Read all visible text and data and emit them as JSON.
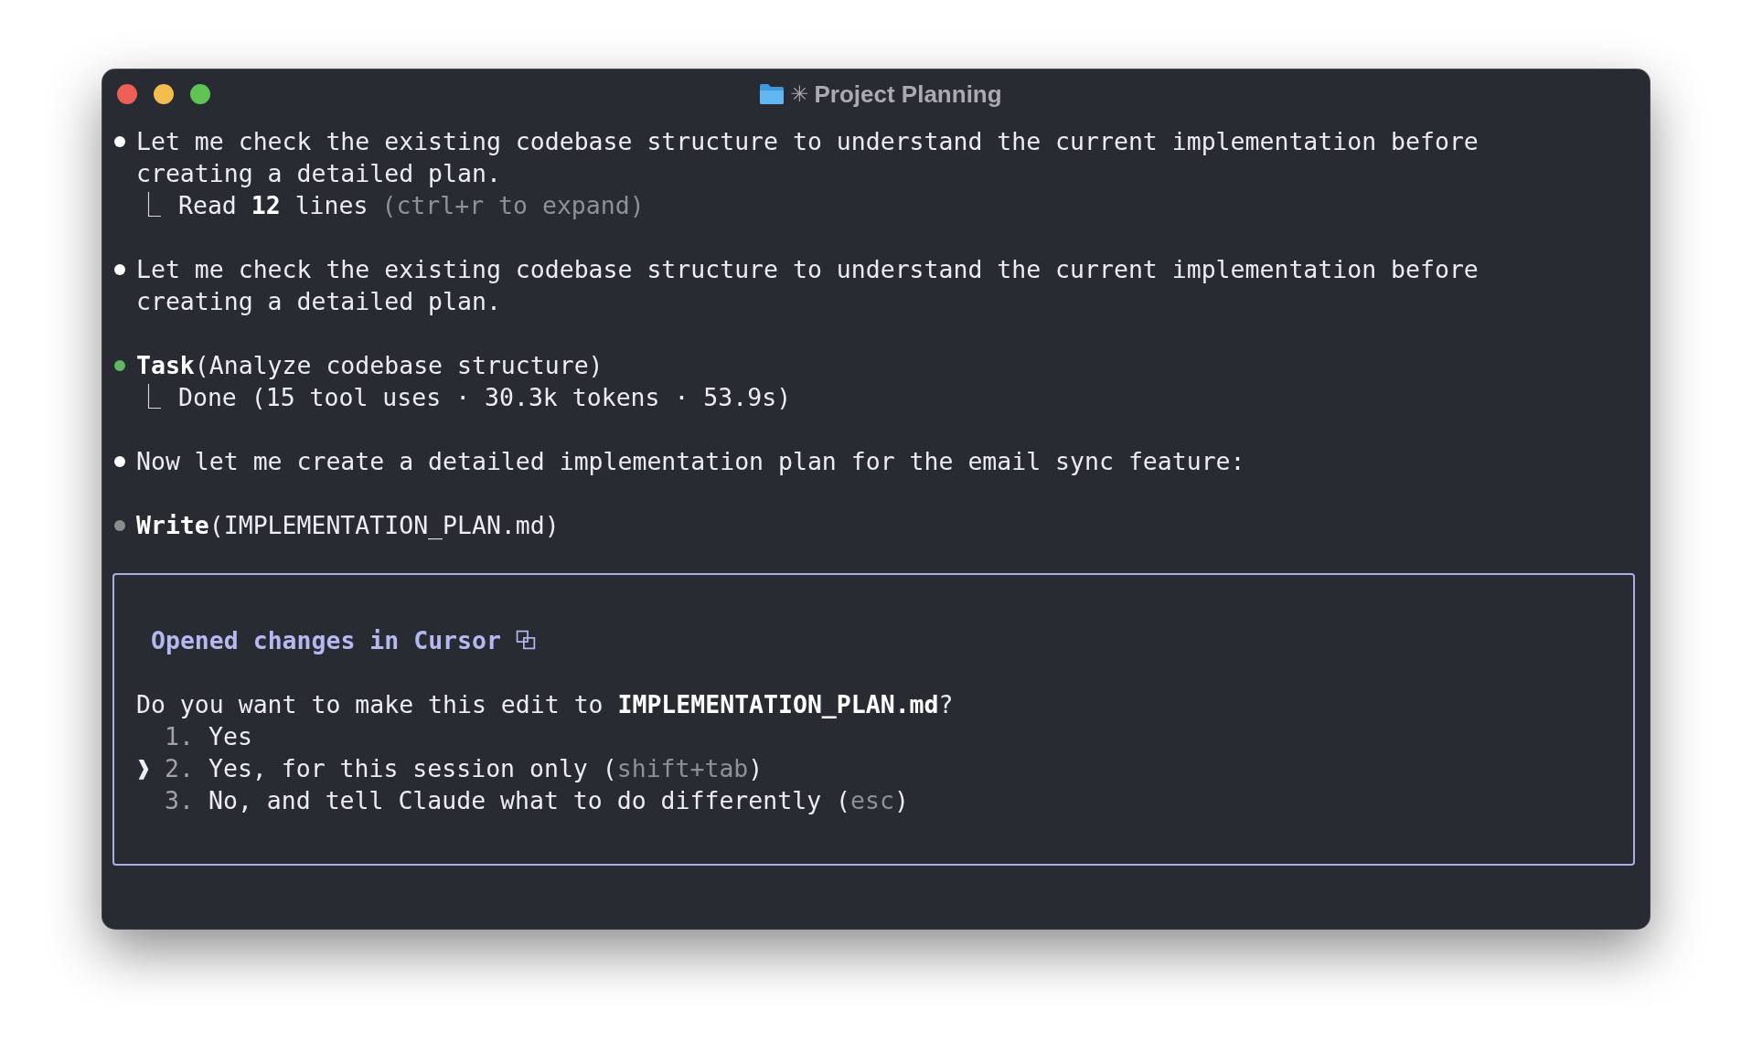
{
  "window": {
    "title_icon_glyph": "✳",
    "title": "Project Planning"
  },
  "messages": [
    {
      "kind": "text",
      "color": "#ffffff",
      "text": "Let me check the existing codebase structure to understand the current implementation before creating a detailed plan.",
      "result": {
        "glyph": "⎿",
        "text": "Read **12** lines",
        "hint": "(ctrl+r to expand)"
      }
    },
    {
      "kind": "text",
      "color": "#ffffff",
      "text": "Let me check the existing codebase structure to understand the current implementation before creating a detailed plan."
    },
    {
      "kind": "tool",
      "color": "#5fb85f",
      "tool": "Task",
      "args": "(Analyze codebase structure)",
      "result": {
        "glyph": "⎿",
        "text": "Done (15 tool uses · 30.3k tokens · 53.9s)"
      }
    },
    {
      "kind": "text",
      "color": "#ffffff",
      "text": "Now let me create a detailed implementation plan for the email sync feature:"
    },
    {
      "kind": "tool",
      "color": "#8c8c8c",
      "tool": "Write",
      "args": "(IMPLEMENTATION_PLAN.md)"
    }
  ],
  "prompt": {
    "header": "Opened changes in Cursor",
    "question": "Do you want to make this edit to **IMPLEMENTATION_PLAN.md**?",
    "pointer": "❱",
    "options": [
      {
        "number": "1.",
        "label": "Yes",
        "selected": false
      },
      {
        "number": "2.",
        "label": "Yes, for this session only (",
        "hint": "shift+tab",
        "close": ")",
        "selected": true
      },
      {
        "number": "3.",
        "label": "No, and tell Claude what to do differently (",
        "hint": "esc",
        "close": ")",
        "selected": false
      }
    ]
  }
}
